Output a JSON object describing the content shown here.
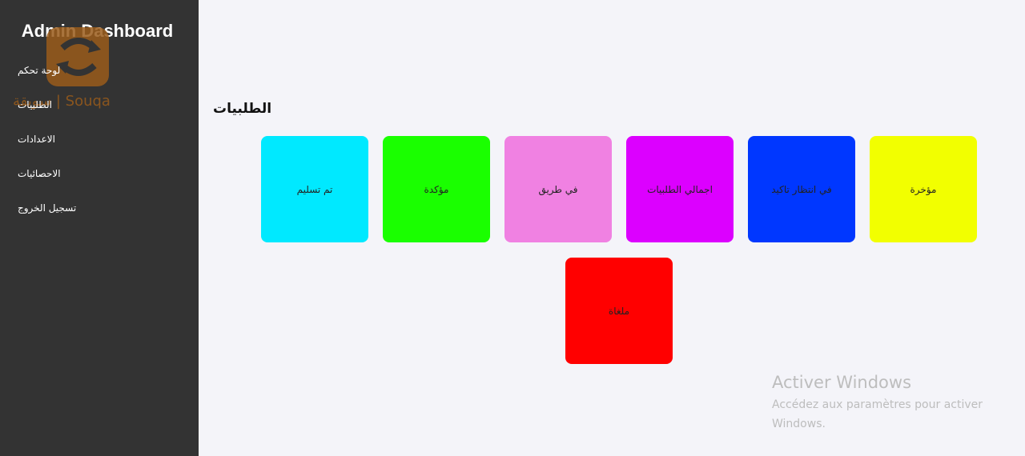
{
  "sidebar": {
    "title": "Admin Dashboard",
    "items": [
      {
        "label": "لوحة تحكم"
      },
      {
        "label": "الطلبيات"
      },
      {
        "label": "الاعدادات"
      },
      {
        "label": "الاحصائيات"
      },
      {
        "label": "تسجيل الخروج"
      }
    ]
  },
  "logo": {
    "text": "سويقة | Souqa",
    "color": "#9a5c1b"
  },
  "main": {
    "title": "الطلبيات",
    "cards": [
      {
        "label": "مؤخرة",
        "color": "#f2ff00"
      },
      {
        "label": "في انتظار تاكيد",
        "color": "#0037ff"
      },
      {
        "label": "اجمالي الطلبيات",
        "color": "#dc00ff"
      },
      {
        "label": "في طريق",
        "color": "#f081e2"
      },
      {
        "label": "مؤكدة",
        "color": "#1aff00"
      },
      {
        "label": "تم تسليم",
        "color": "#00e9ff"
      },
      {
        "label": "ملغاة",
        "color": "#ff0000"
      }
    ]
  },
  "watermark": {
    "title": "Activer Windows",
    "line1": "Accédez aux paramètres pour activer",
    "line2": "Windows."
  }
}
